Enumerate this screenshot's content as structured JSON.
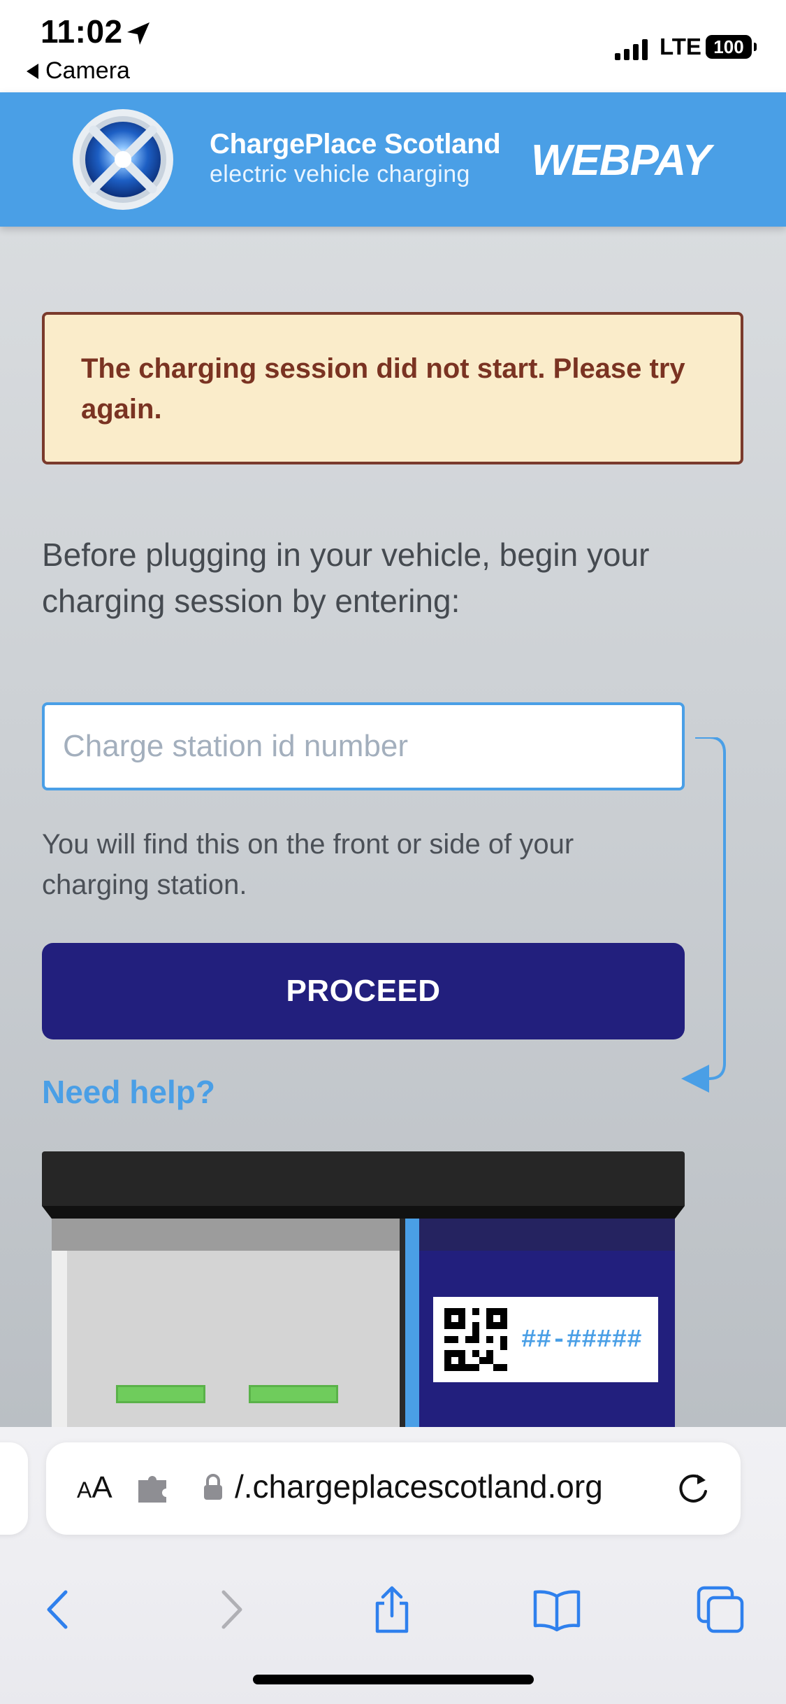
{
  "status_bar": {
    "time": "11:02",
    "back_app": "Camera",
    "network": "LTE",
    "battery": "100",
    "icons": [
      "location-arrow-icon",
      "signal-bars-icon",
      "battery-icon"
    ]
  },
  "header": {
    "brand_name": "ChargePlace Scotland",
    "tagline": "electric vehicle charging",
    "product": "WEBPAY",
    "brand_color": "#4a9fe6"
  },
  "alert": {
    "message": "The charging session did not start. Please try again.",
    "background": "#faecca",
    "text_color": "#7a3322"
  },
  "form": {
    "intro": "Before plugging in your vehicle, begin your charging session by entering:",
    "input_placeholder": "Charge station id number",
    "input_value": "",
    "helper": "You will find this on the front or side of your charging station.",
    "proceed_label": "PROCEED",
    "proceed_color": "#221f7d",
    "help_link": "Need help?"
  },
  "illustration": {
    "id_mask": "##-#####",
    "icons": [
      "qr-code-icon",
      "pointer-arrow-icon"
    ]
  },
  "browser": {
    "aa_label_small": "A",
    "aa_label_large": "A",
    "url": "/.chargeplacescotland.org",
    "icons": [
      "extension-icon",
      "lock-icon",
      "reload-icon",
      "back-chevron-icon",
      "forward-chevron-icon",
      "share-icon",
      "bookmarks-icon",
      "tabs-icon"
    ]
  }
}
